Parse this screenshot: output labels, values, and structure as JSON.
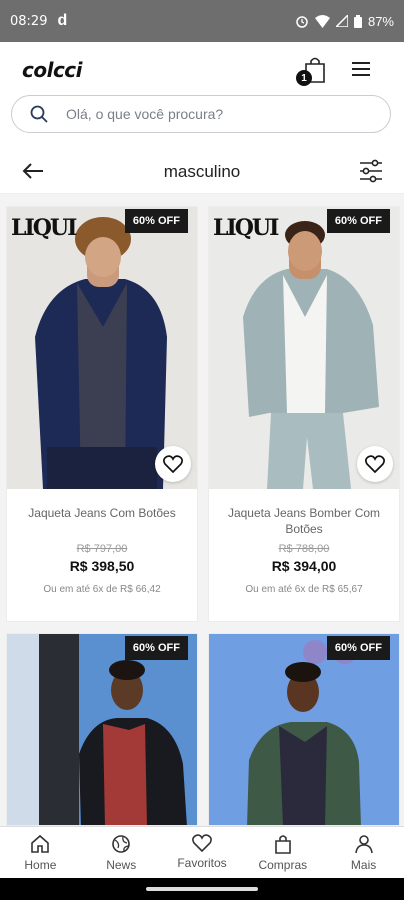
{
  "status_bar": {
    "time": "08:29",
    "app_glyph": "d",
    "battery": "87%"
  },
  "header": {
    "logo": "colcci",
    "cart_count": "1"
  },
  "search": {
    "placeholder": "Olá, o que você procura?"
  },
  "title_bar": {
    "title": "masculino"
  },
  "products": [
    {
      "brand": "LIQUI",
      "discount": "60% OFF",
      "name": "Jaqueta Jeans Com Botões",
      "old_price": "R$ 797,00",
      "price": "R$ 398,50",
      "installments": "Ou em até 6x de R$ 66,42"
    },
    {
      "brand": "LIQUI",
      "discount": "60% OFF",
      "name": "Jaqueta Jeans Bomber Com Botões",
      "old_price": "R$ 788,00",
      "price": "R$ 394,00",
      "installments": "Ou em até 6x de R$ 65,67"
    },
    {
      "brand": "",
      "discount": "60% OFF"
    },
    {
      "brand": "",
      "discount": "60% OFF"
    }
  ],
  "bottom_nav": [
    {
      "label": "Home",
      "icon": "home-icon"
    },
    {
      "label": "News",
      "icon": "globe-icon"
    },
    {
      "label": "Favoritos",
      "icon": "heart-icon"
    },
    {
      "label": "Compras",
      "icon": "bag-icon"
    },
    {
      "label": "Mais",
      "icon": "user-icon"
    }
  ]
}
